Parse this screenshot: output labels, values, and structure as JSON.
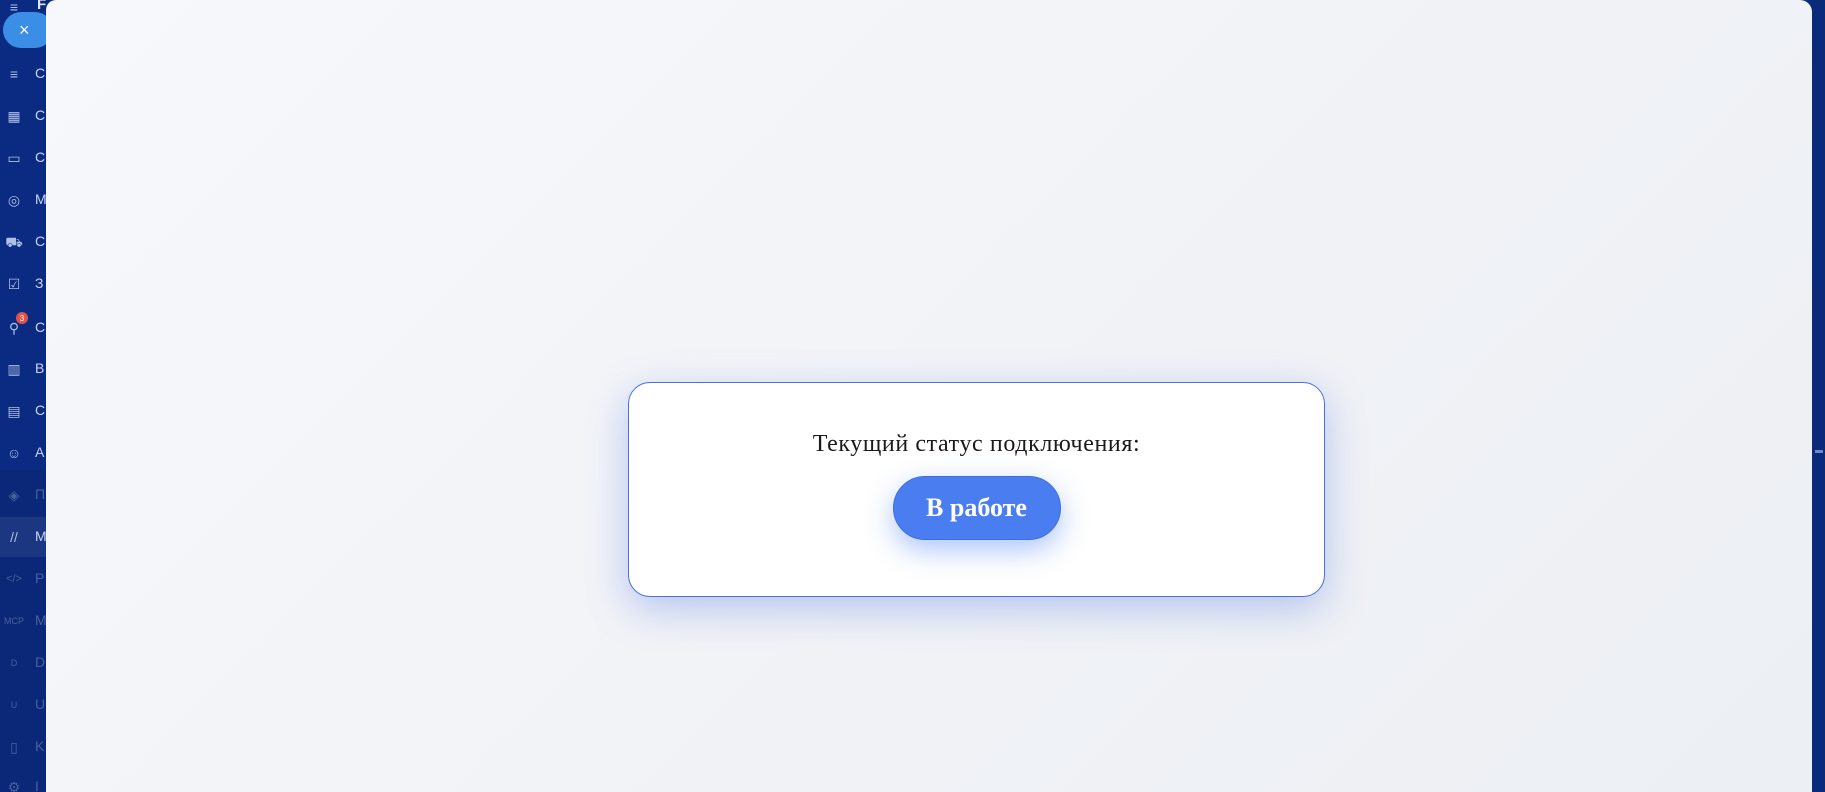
{
  "sidebar": {
    "close_symbol": "×",
    "top_letter": "F",
    "items": [
      {
        "icon": "funnel-icon",
        "glyph": "≡",
        "label": "C"
      },
      {
        "icon": "calendar-icon",
        "glyph": "▦",
        "label": "C"
      },
      {
        "icon": "storage-icon",
        "glyph": "▭",
        "label": "C"
      },
      {
        "icon": "target-icon",
        "glyph": "◎",
        "label": "M"
      },
      {
        "icon": "cart-icon",
        "glyph": "⛟",
        "label": "C"
      },
      {
        "icon": "checkbox-icon",
        "glyph": "☑",
        "label": "З"
      },
      {
        "icon": "share-nodes-icon",
        "glyph": "⚲",
        "label": "C",
        "badge": "3"
      },
      {
        "icon": "bar-chart-icon",
        "glyph": "▥",
        "label": "B"
      },
      {
        "icon": "card-icon",
        "glyph": "▤",
        "label": "C"
      },
      {
        "icon": "robot-icon",
        "glyph": "☺",
        "label": "A"
      },
      {
        "icon": "box-icon",
        "glyph": "◈",
        "label": "П"
      },
      {
        "icon": "brand-m-icon",
        "glyph": "//",
        "label": "M"
      },
      {
        "icon": "code-icon",
        "glyph": "</>",
        "label": "P"
      },
      {
        "icon": "mcp-icon",
        "glyph": "MCP",
        "label": "M"
      },
      {
        "icon": "circle-d-icon",
        "glyph": "D",
        "label": "D"
      },
      {
        "icon": "circle-u-icon",
        "glyph": "U",
        "label": "U"
      },
      {
        "icon": "document-icon",
        "glyph": "▯",
        "label": "K"
      },
      {
        "icon": "settings-icon",
        "glyph": "⚙",
        "label": "I"
      }
    ]
  },
  "status_card": {
    "heading": "Текущий статус подключения:",
    "status_label": "В работе"
  }
}
